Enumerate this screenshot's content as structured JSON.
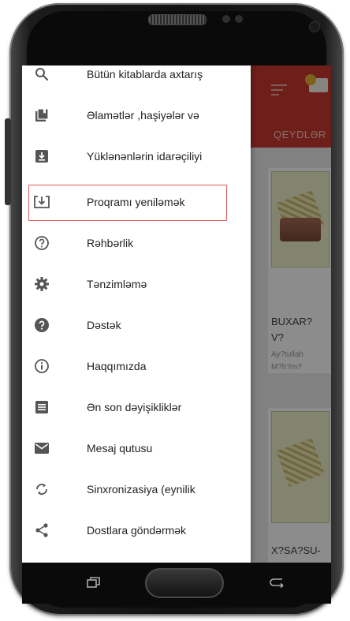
{
  "app": {
    "tab_label": "QEYDLƏR",
    "cards": [
      {
        "title_line1": "BUXAR?",
        "title_line2": "V?",
        "sub_line1": "Ay?tullah",
        "sub_line2": "M?h?m?"
      },
      {
        "title_line1": "X?SA?SU-"
      }
    ]
  },
  "drawer": {
    "items": [
      {
        "label": "Bütün kitablarda axtarış",
        "icon": "search-icon"
      },
      {
        "label": "Əlamətlər ,haşiyələr və",
        "icon": "bookmarks-icon"
      },
      {
        "label": "Yüklənənlərin idarəçiliyi",
        "icon": "download-box-icon"
      },
      {
        "label": "Proqramı yeniləmək",
        "icon": "update-icon"
      },
      {
        "label": "Rəhbərlik",
        "icon": "help-outline-icon"
      },
      {
        "label": "Tənzimləmə",
        "icon": "gear-icon"
      },
      {
        "label": "Dəstək",
        "icon": "help-filled-icon"
      },
      {
        "label": "Haqqımızda",
        "icon": "info-icon"
      },
      {
        "label": "Ən son dəyişikliklər",
        "icon": "list-icon"
      },
      {
        "label": "Mesaj qutusu",
        "icon": "mail-icon"
      },
      {
        "label": "Sinxronizasiya (eynilik",
        "icon": "sync-icon"
      },
      {
        "label": "Dostlara göndərmək",
        "icon": "share-icon"
      }
    ]
  },
  "colors": {
    "app_bar": "#c9392f",
    "highlight": "#e05b5b",
    "icon": "#555555"
  }
}
